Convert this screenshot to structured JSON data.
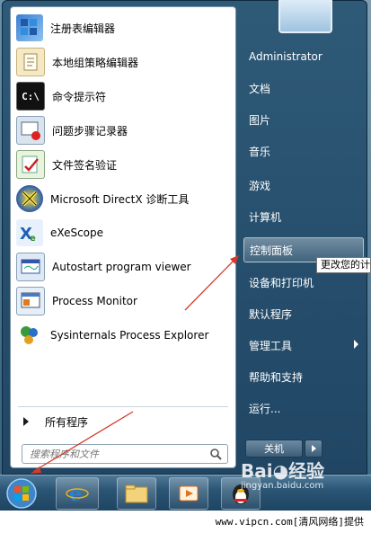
{
  "programs": [
    {
      "label": "注册表编辑器",
      "icon": "registry-editor-icon"
    },
    {
      "label": "本地组策略编辑器",
      "icon": "group-policy-icon"
    },
    {
      "label": "命令提示符",
      "icon": "cmd-icon"
    },
    {
      "label": "问题步骤记录器",
      "icon": "steps-recorder-icon"
    },
    {
      "label": "文件签名验证",
      "icon": "sigverif-icon"
    },
    {
      "label": "Microsoft DirectX 诊断工具",
      "icon": "directx-icon"
    },
    {
      "label": "eXeScope",
      "icon": "exescope-icon"
    },
    {
      "label": "Autostart program viewer",
      "icon": "autostart-viewer-icon"
    },
    {
      "label": "Process Monitor",
      "icon": "process-monitor-icon"
    },
    {
      "label": "Sysinternals Process Explorer",
      "icon": "process-explorer-icon"
    }
  ],
  "all_programs_label": "所有程序",
  "search": {
    "placeholder": "搜索程序和文件"
  },
  "right_items": [
    {
      "label": "Administrator"
    },
    {
      "label": "文档"
    },
    {
      "label": "图片"
    },
    {
      "label": "音乐"
    },
    {
      "label": "游戏"
    },
    {
      "label": "计算机"
    },
    {
      "label": "控制面板"
    },
    {
      "label": "设备和打印机"
    },
    {
      "label": "默认程序"
    },
    {
      "label": "管理工具"
    },
    {
      "label": "帮助和支持"
    },
    {
      "label": "运行..."
    }
  ],
  "tooltip": "更改您的计",
  "shutdown_label": "关机",
  "watermark": {
    "brand": "Bai",
    "brand_suffix": "经验",
    "url": "jingyan.baidu.com"
  },
  "footer_text": "www.vipcn.com[清风网络]提供"
}
